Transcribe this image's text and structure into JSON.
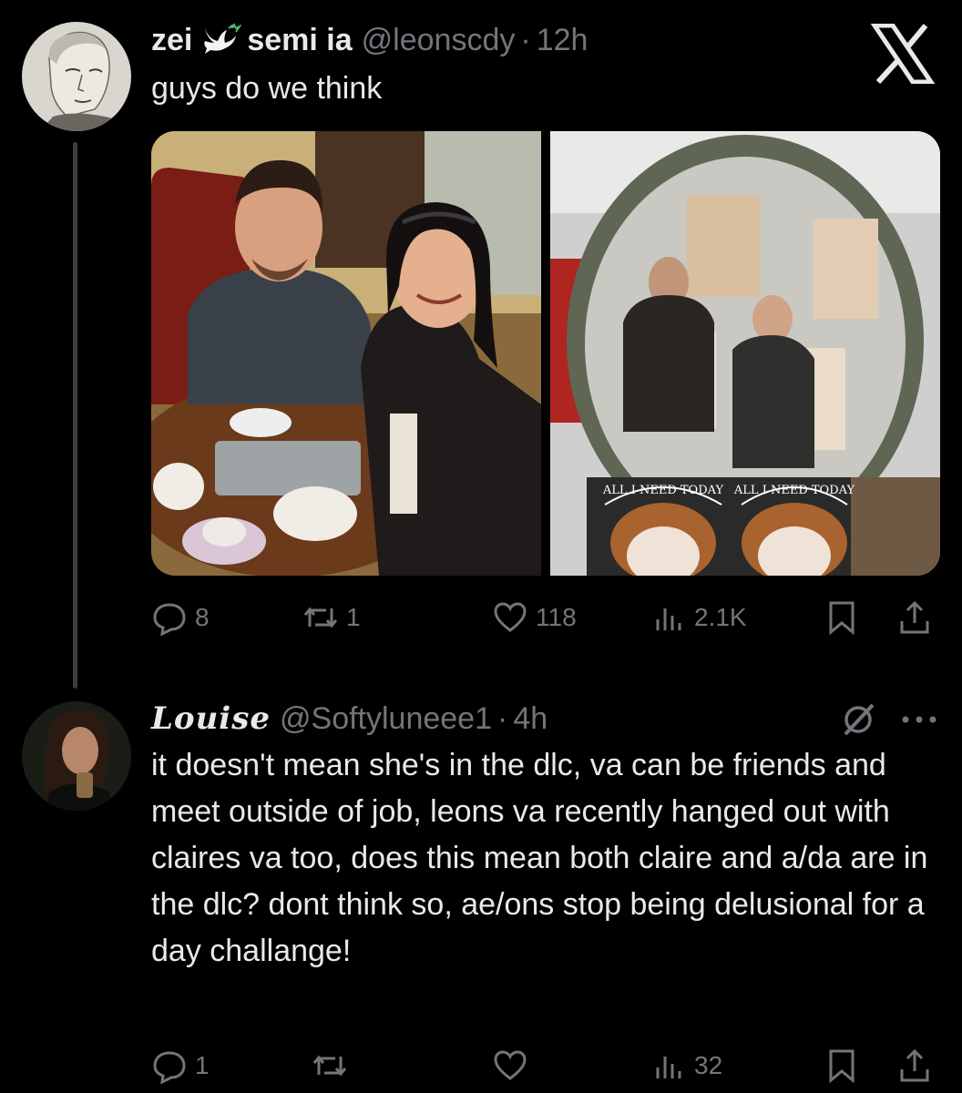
{
  "tweet1": {
    "display_name_left": "zei",
    "display_name_right": "semi ia",
    "handle": "@leonscdy",
    "separator": "·",
    "time": "12h",
    "text": "guys do we think",
    "actions": {
      "replies": "8",
      "reposts": "1",
      "likes": "118",
      "views": "2.1K"
    }
  },
  "reply": {
    "display_name": "Louise",
    "handle": "@Softyluneee1",
    "separator": "·",
    "time": "4h",
    "text": "it doesn't mean she's in the dlc, va can be friends and meet outside of job, leons va recently hanged out with claires va too, does this mean both claire and a/da are in the dlc? dont think so, ae/ons stop being delusional for a day challange!",
    "actions": {
      "replies": "1",
      "reposts": "",
      "likes": "",
      "views": "32"
    }
  },
  "media": {
    "photo_left_sign": "",
    "photo_right_sign_text": "ALL I NEED TODAY"
  },
  "colors": {
    "background": "#000000",
    "text_primary": "#e7e9ea",
    "text_secondary": "#71767b",
    "thread_line": "#3a3d41"
  },
  "icons": [
    "dove-icon",
    "x-logo-icon",
    "grok-icon",
    "more-icon",
    "reply-icon",
    "repost-icon",
    "like-icon",
    "views-icon",
    "bookmark-icon",
    "share-icon"
  ]
}
